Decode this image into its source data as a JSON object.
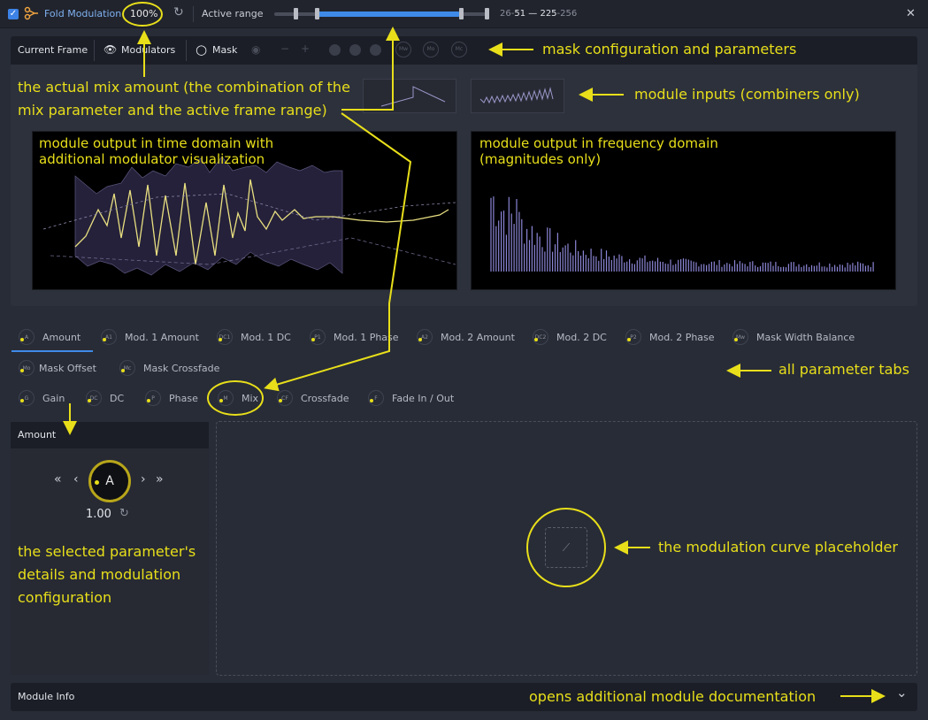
{
  "topbar": {
    "enabled_checkbox": "✓",
    "module_icon": "fold-modulation-icon",
    "module_name": "Fold Modulation",
    "mix_value": "100%",
    "reset_icon": "↻",
    "active_range_label": "Active range",
    "range_start_low": "26",
    "range_start": "51",
    "range_sep": "—",
    "range_end": "225",
    "range_end_high": "256",
    "close_icon": "✕",
    "range_fraction": {
      "min": 0.1,
      "start": 0.2,
      "end": 0.88,
      "max": 1.0
    }
  },
  "frame_toolbar": {
    "current_frame": "Current Frame",
    "modulators_icon": "👁",
    "modulators": "Modulators",
    "mask_icon": "○",
    "mask": "Mask",
    "disabled_icons": [
      "eye-icon",
      "minus-icon",
      "plus-icon",
      "check-icon",
      "check-icon",
      "check-icon"
    ],
    "mask_knobs": [
      "Mw",
      "Mo",
      "Mc"
    ]
  },
  "parameter_tabs": {
    "row1": [
      {
        "knob": "A",
        "label": "Amount"
      },
      {
        "knob": "A1",
        "label": "Mod. 1 Amount"
      },
      {
        "knob": "DC1",
        "label": "Mod. 1 DC"
      },
      {
        "knob": "P1",
        "label": "Mod. 1 Phase"
      },
      {
        "knob": "A2",
        "label": "Mod. 2 Amount"
      },
      {
        "knob": "DC2",
        "label": "Mod. 2 DC"
      },
      {
        "knob": "P2",
        "label": "Mod. 2 Phase"
      },
      {
        "knob": "Mw",
        "label": "Mask Width Balance"
      }
    ],
    "row2": [
      {
        "knob": "Mo",
        "label": "Mask Offset"
      },
      {
        "knob": "Mc",
        "label": "Mask Crossfade"
      }
    ],
    "row3": [
      {
        "knob": "G",
        "label": "Gain"
      },
      {
        "knob": "DC",
        "label": "DC"
      },
      {
        "knob": "P",
        "label": "Phase"
      },
      {
        "knob": "M",
        "label": "Mix"
      },
      {
        "knob": "CF",
        "label": "Crossfade"
      },
      {
        "knob": "F",
        "label": "Fade In / Out"
      }
    ]
  },
  "amount_panel": {
    "title": "Amount",
    "nav_first": "«",
    "nav_prev": "‹",
    "knob_label": "A",
    "nav_next": "›",
    "nav_last": "»",
    "value": "1.00",
    "reset_icon": "↻"
  },
  "curve": {
    "placeholder_icon": "chart-icon",
    "placeholder_glyph": "⟋"
  },
  "module_info": {
    "title": "Module Info",
    "chevron": "⌄"
  },
  "annotations": {
    "mask": "mask configuration and parameters",
    "mix_line1": "the actual mix amount (the combination of the",
    "mix_line2": "mix parameter and the active frame range)",
    "inputs": "module inputs (combiners only)",
    "time_line1": "module output in time domain with",
    "time_line2": "additional modulator visualization",
    "freq_line1": "module output in frequency domain",
    "freq_line2": "(magnitudes only)",
    "tabs": "all parameter tabs",
    "details_line1": "the selected parameter's",
    "details_line2": "details and modulation",
    "details_line3": "configuration",
    "curve": "the modulation curve placeholder",
    "docs": "opens additional module documentation"
  },
  "colors": {
    "accent": "#3f8ae8",
    "annotation": "#e8df1a",
    "background": "#282c37",
    "waveform": "#e8df80",
    "spectrum": "#8b86d6"
  }
}
